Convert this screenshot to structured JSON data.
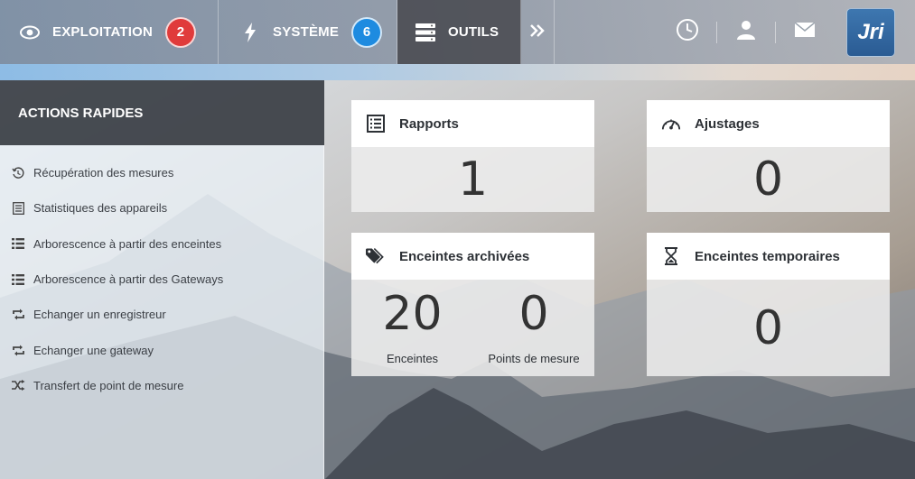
{
  "nav": {
    "items": [
      {
        "label": "EXPLOITATION",
        "icon": "eye-icon",
        "badge": "2",
        "badge_color": "#e03b3b"
      },
      {
        "label": "SYSTÈME",
        "icon": "bolt-icon",
        "badge": "6",
        "badge_color": "#1e8be0"
      },
      {
        "label": "OUTILS",
        "icon": "server-icon",
        "active": true
      }
    ],
    "more_icon": "double-chevron-right-icon",
    "right_icons": [
      "clock-icon",
      "user-icon",
      "mail-icon"
    ],
    "logo_text": "Jri"
  },
  "sidebar": {
    "title": "ACTIONS RAPIDES",
    "items": [
      {
        "label": "Récupération des mesures",
        "icon": "history-icon"
      },
      {
        "label": "Statistiques des appareils",
        "icon": "document-list-icon"
      },
      {
        "label": "Arborescence à partir des enceintes",
        "icon": "list-icon"
      },
      {
        "label": "Arborescence à partir des Gateways",
        "icon": "list-icon"
      },
      {
        "label": "Echanger un enregistreur",
        "icon": "swap-icon"
      },
      {
        "label": "Echanger une gateway",
        "icon": "swap-icon"
      },
      {
        "label": "Transfert de point de mesure",
        "icon": "shuffle-icon"
      }
    ]
  },
  "cards": {
    "rapports": {
      "title": "Rapports",
      "icon": "report-icon",
      "value": "1"
    },
    "ajustages": {
      "title": "Ajustages",
      "icon": "gauge-icon",
      "value": "0"
    },
    "archivees": {
      "title": "Enceintes archivées",
      "icon": "tags-icon",
      "enceintes_value": "20",
      "enceintes_label": "Enceintes",
      "points_value": "0",
      "points_label": "Points de mesure"
    },
    "temporaires": {
      "title": "Enceintes temporaires",
      "icon": "hourglass-icon",
      "value": "0"
    }
  }
}
